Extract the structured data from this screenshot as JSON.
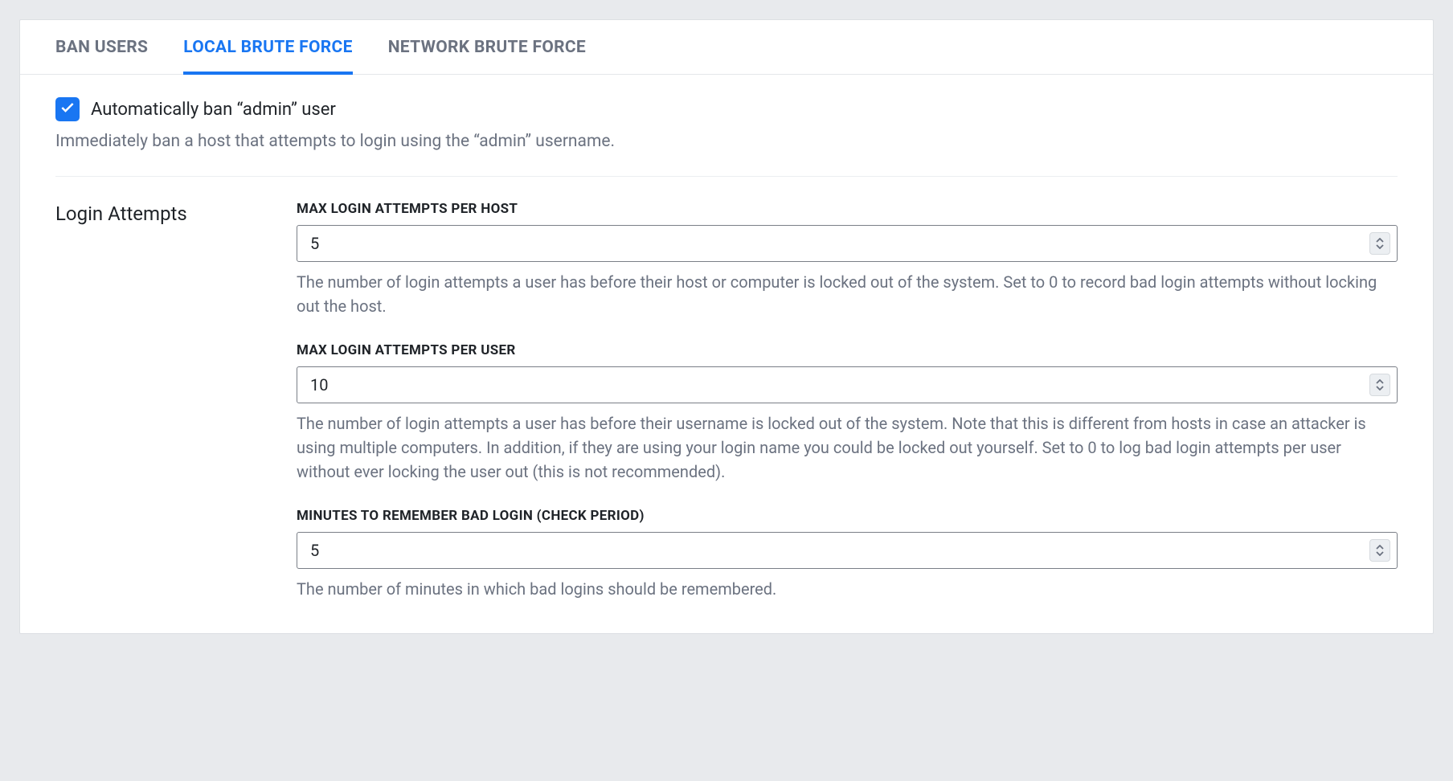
{
  "tabs": [
    {
      "label": "BAN USERS",
      "active": false
    },
    {
      "label": "LOCAL BRUTE FORCE",
      "active": true
    },
    {
      "label": "NETWORK BRUTE FORCE",
      "active": false
    }
  ],
  "auto_ban": {
    "checked": true,
    "label": "Automatically ban “admin” user",
    "description": "Immediately ban a host that attempts to login using the “admin” username."
  },
  "section_title": "Login Attempts",
  "fields": {
    "max_host": {
      "label": "MAX LOGIN ATTEMPTS PER HOST",
      "value": "5",
      "description": "The number of login attempts a user has before their host or computer is locked out of the system. Set to 0 to record bad login attempts without locking out the host."
    },
    "max_user": {
      "label": "MAX LOGIN ATTEMPTS PER USER",
      "value": "10",
      "description": "The number of login attempts a user has before their username is locked out of the system. Note that this is different from hosts in case an attacker is using multiple computers. In addition, if they are using your login name you could be locked out yourself. Set to 0 to log bad login attempts per user without ever locking the user out (this is not recommended)."
    },
    "minutes": {
      "label": "MINUTES TO REMEMBER BAD LOGIN (CHECK PERIOD)",
      "value": "5",
      "description": "The number of minutes in which bad logins should be remembered."
    }
  }
}
